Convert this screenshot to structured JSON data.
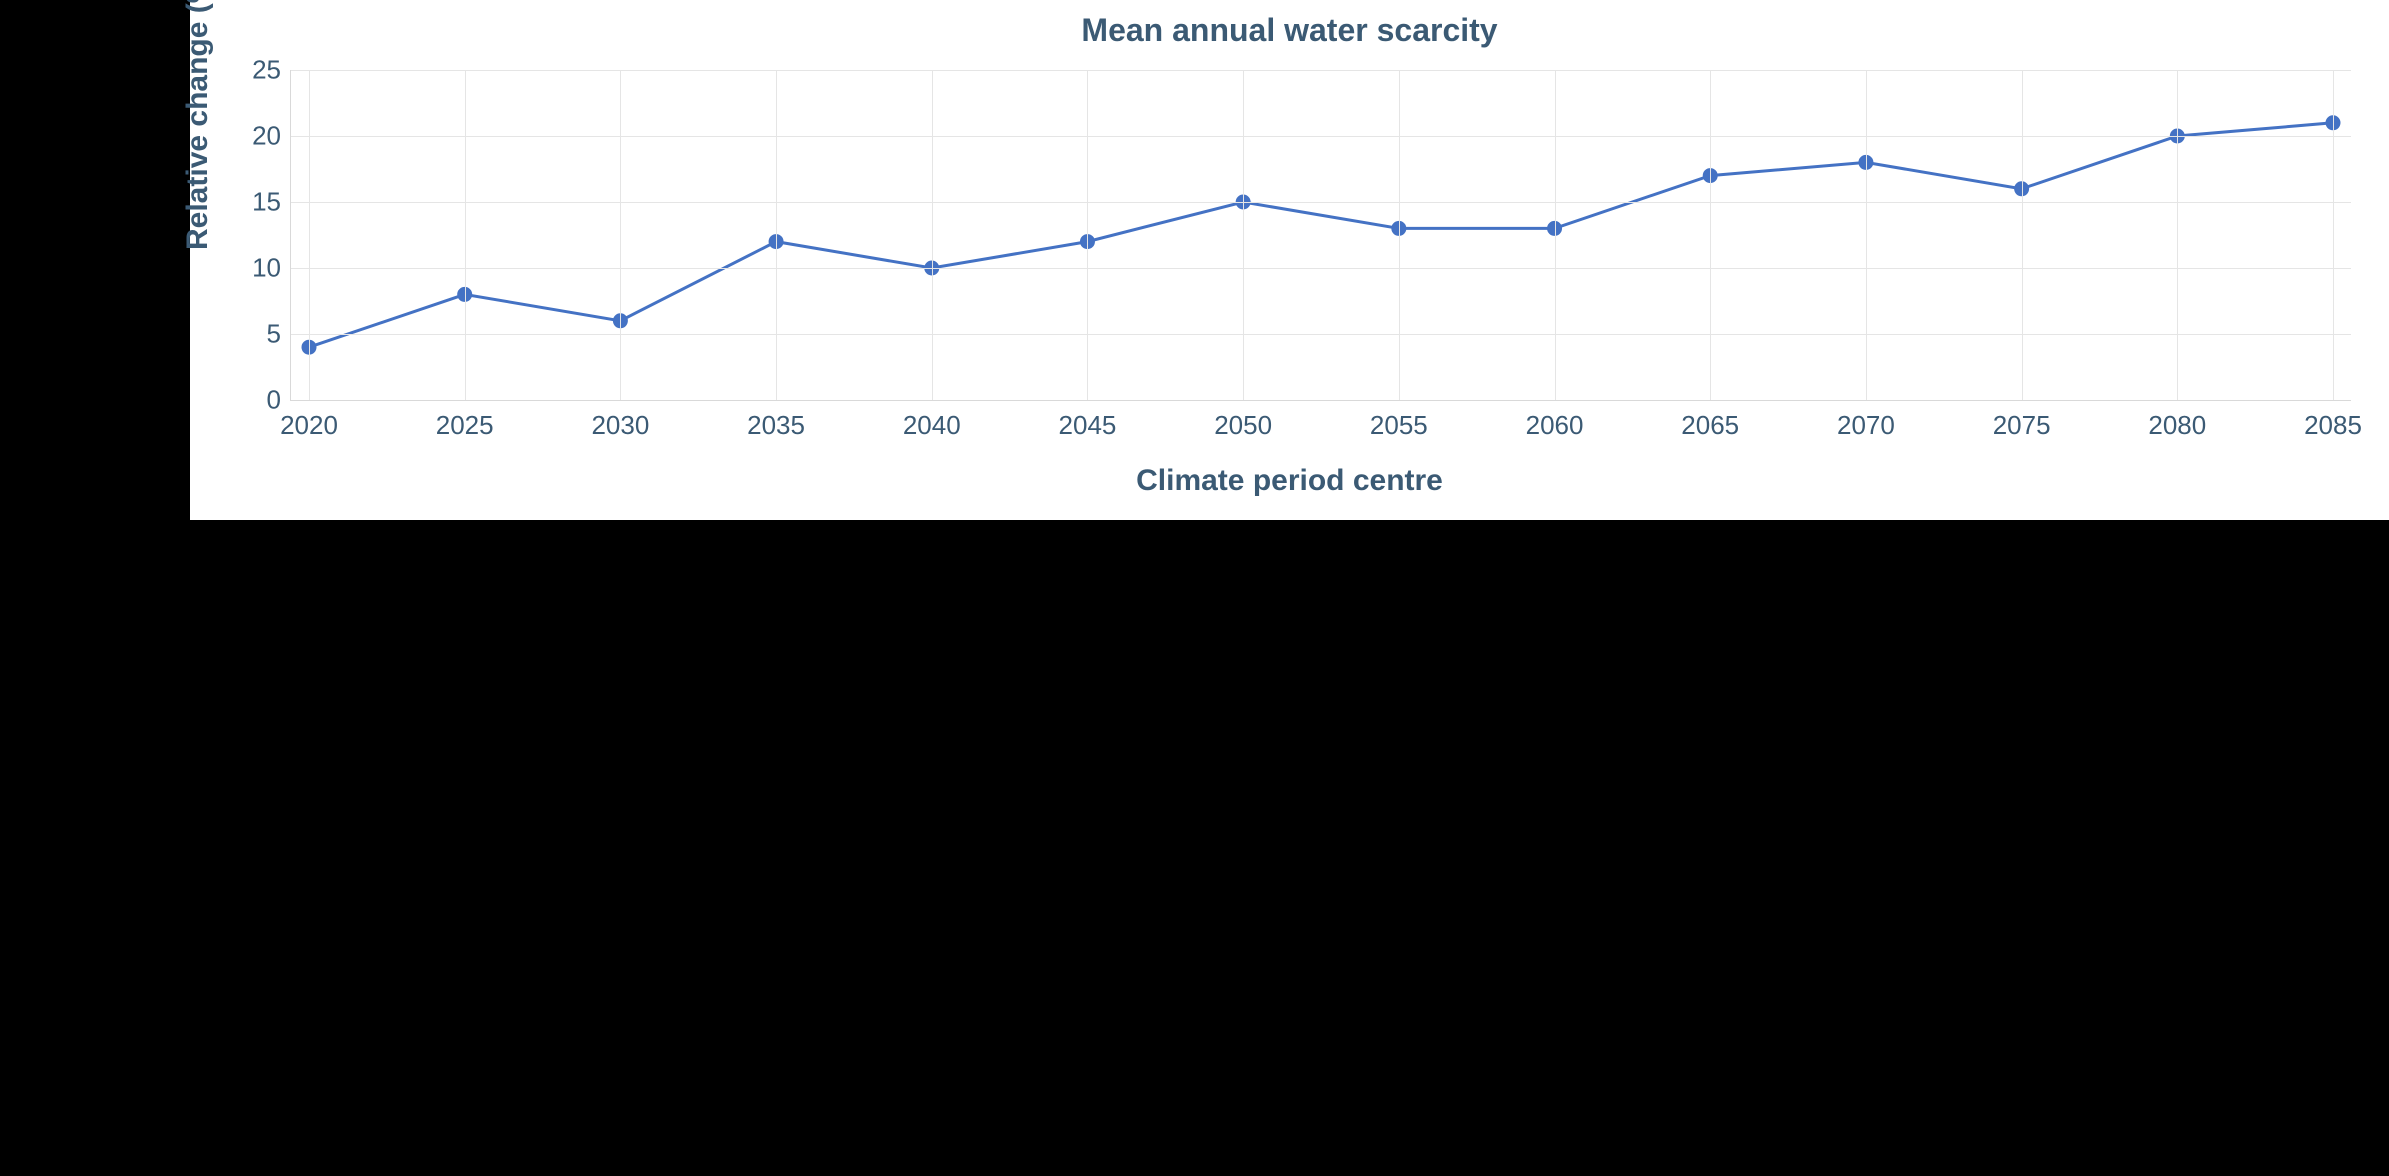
{
  "chart_data": {
    "type": "line",
    "title": "Mean annual water scarcity",
    "xlabel": "Climate period centre",
    "ylabel": "Relative change (%)",
    "ylim": [
      0,
      25
    ],
    "y_ticks": [
      0,
      5,
      10,
      15,
      20,
      25
    ],
    "categories": [
      "2020",
      "2025",
      "2030",
      "2035",
      "2040",
      "2045",
      "2050",
      "2055",
      "2060",
      "2065",
      "2070",
      "2075",
      "2080",
      "2085"
    ],
    "values": [
      4,
      8,
      6,
      12,
      10,
      12,
      15,
      13,
      13,
      17,
      18,
      16,
      20,
      21
    ]
  },
  "annotations": {
    "dotted_line_categories": [
      "2020",
      "2025",
      "2030"
    ]
  }
}
